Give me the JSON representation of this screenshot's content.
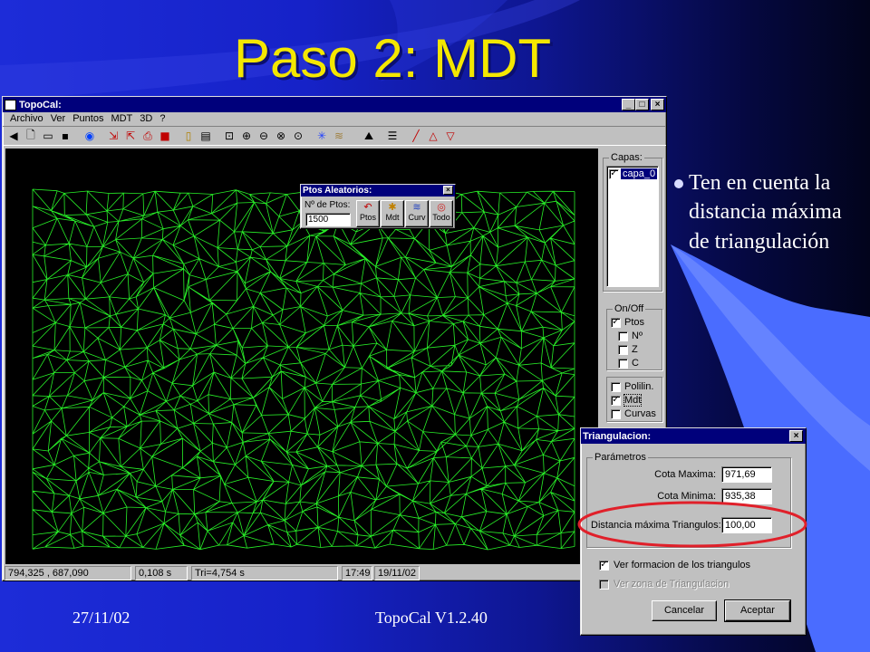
{
  "slide": {
    "title": "Paso 2: MDT",
    "bullet": "Ten en cuenta la distancia máxima de triangulación",
    "footer_date": "27/11/02",
    "footer_app": "TopoCal V1.2.40"
  },
  "colors": {
    "title": "#f4e700",
    "mesh": "#28f028",
    "highlight": "#e0202a",
    "accent": "#4a6cff"
  },
  "main_window": {
    "title": "TopoCal:",
    "menu": [
      "Archivo",
      "Ver",
      "Puntos",
      "MDT",
      "3D",
      "?"
    ],
    "title_buttons": [
      "_",
      "□",
      "×"
    ],
    "toolbar_icons": [
      "back-icon",
      "new-file-icon",
      "open-folder-icon",
      "save-icon",
      "globe-icon",
      "import-icon",
      "export-icon",
      "print-setup-icon",
      "print-icon",
      "page-icon",
      "preview-icon",
      "zoom-window-icon",
      "zoom-in-icon",
      "zoom-out-icon",
      "zoom-all-icon",
      "zoom-previous-icon",
      "network-icon",
      "contour-icon",
      "profile-icon",
      "layers-icon",
      "line-icon",
      "triangle-icon",
      "triangle-down-icon"
    ],
    "layers": {
      "label": "Capas:",
      "items": [
        {
          "name": "capa_0",
          "checked": true
        }
      ]
    },
    "onoff": {
      "label": "On/Off",
      "items": [
        {
          "label": "Ptos",
          "checked": true
        },
        {
          "label": "Nº",
          "checked": false
        },
        {
          "label": "Z",
          "checked": false
        },
        {
          "label": "C",
          "checked": false
        }
      ]
    },
    "objects": {
      "items": [
        {
          "label": "Polilin.",
          "checked": false
        },
        {
          "label": "Mdt",
          "checked": true
        },
        {
          "label": "Curvas",
          "checked": false
        }
      ]
    },
    "status": [
      "794,325 , 687,090",
      "0,108 s",
      "Tri=4,754 s",
      "17:49",
      "19/11/02"
    ]
  },
  "random_points_dialog": {
    "title": "Ptos Aleatorios:",
    "count_label": "Nº de Ptos:",
    "count_value": "1500",
    "buttons": [
      "Ptos",
      "Mdt",
      "Curv",
      "Todo"
    ]
  },
  "triangulation_dialog": {
    "title": "Triangulacion:",
    "group_label": "Parámetros",
    "cota_max_label": "Cota Maxima:",
    "cota_max_value": "971,69",
    "cota_min_label": "Cota Minima:",
    "cota_min_value": "935,38",
    "dist_label": "Distancia máxima Triangulos:",
    "dist_value": "100,00",
    "ver_formacion_label": "Ver formacion de los triangulos",
    "ver_formacion_checked": true,
    "ver_zona_label": "Ver zona de Triangulacion",
    "ver_zona_checked": false,
    "cancel_label": "Cancelar",
    "accept_label": "Aceptar"
  }
}
